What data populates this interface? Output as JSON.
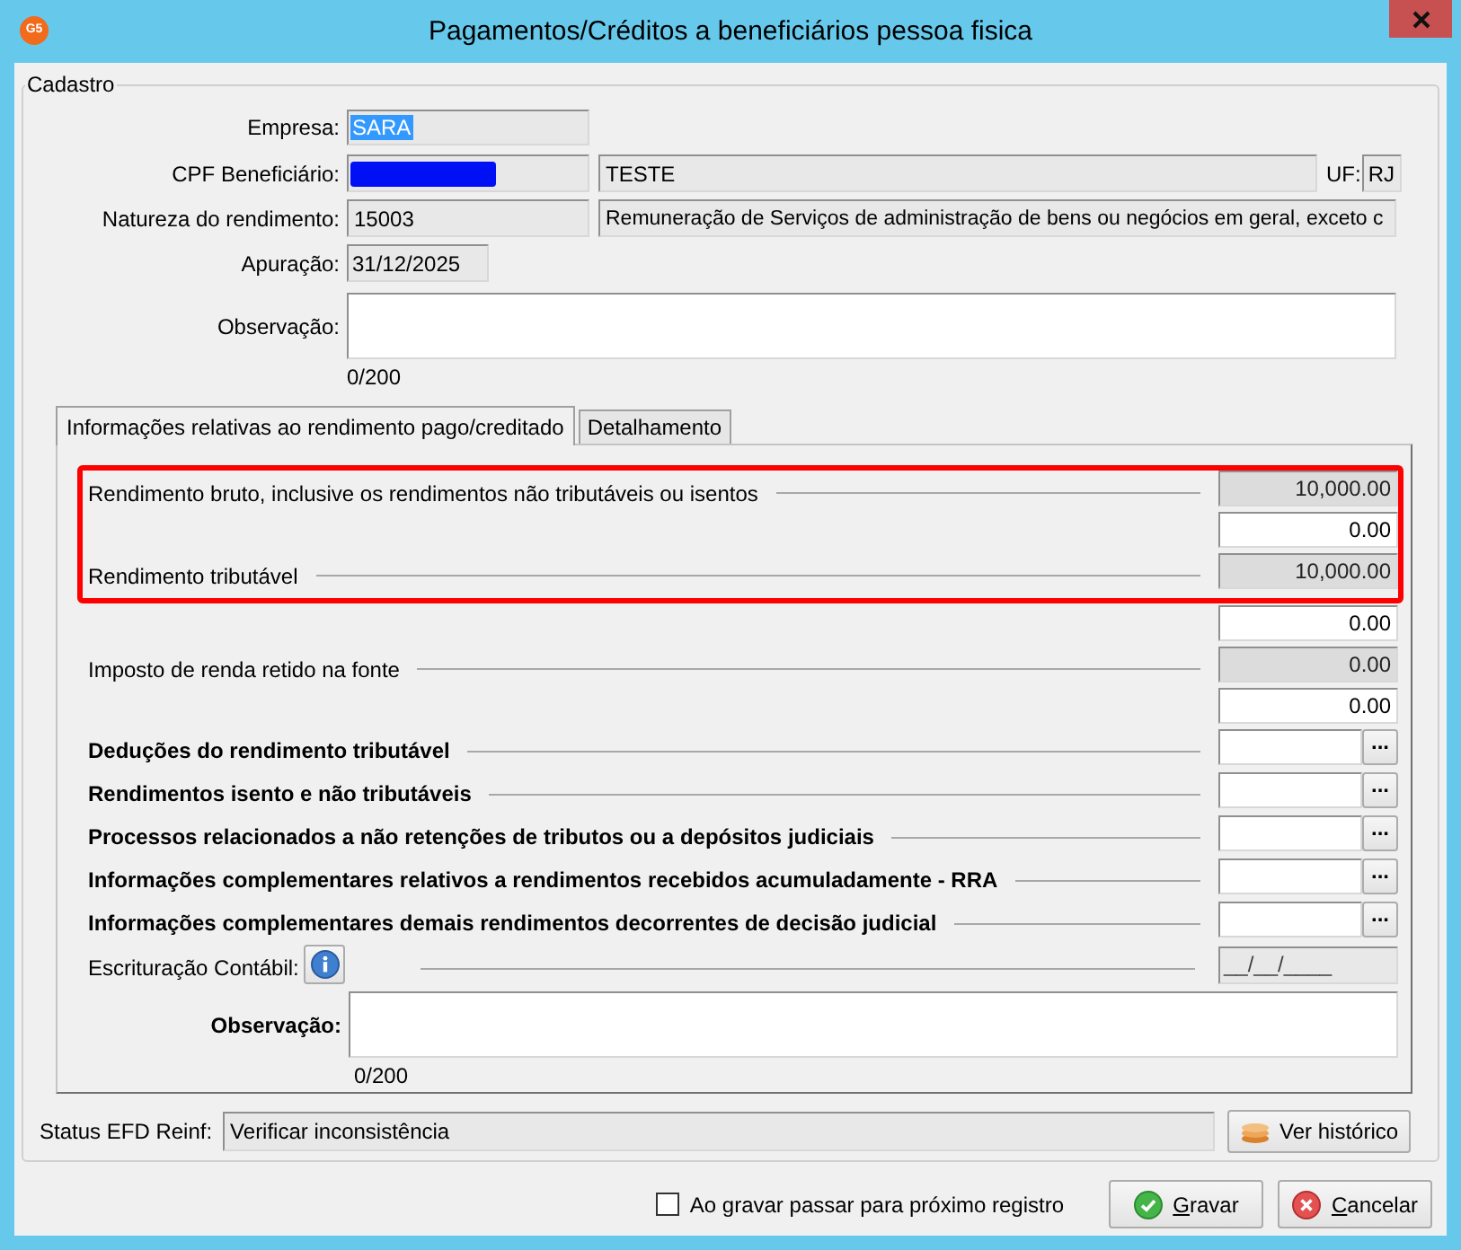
{
  "window": {
    "title": "Pagamentos/Créditos a beneficiários pessoa fisica",
    "logo": "G5"
  },
  "cadastro": {
    "title": "Cadastro",
    "empresa": {
      "label": "Empresa:",
      "value": "SARA",
      "text_selected": true
    },
    "cpf": {
      "label": "CPF Beneficiário:",
      "redacted": true,
      "name": "TESTE",
      "uf_label": "UF:",
      "uf": "RJ"
    },
    "natureza": {
      "label": "Natureza do rendimento:",
      "code": "15003",
      "description": "Remuneração de Serviços de administração de bens ou negócios em geral, exceto c"
    },
    "apuracao": {
      "label": "Apuração:",
      "value": "31/12/2025"
    },
    "observacao": {
      "label": "Observação:",
      "counter": "0/200"
    },
    "tabs": [
      {
        "label": "Informações relativas ao rendimento pago/creditado",
        "selected": true
      },
      {
        "label": "Detalhamento",
        "selected": false
      }
    ],
    "rendimento": {
      "amount_rows": [
        {
          "label": "Rendimento bruto, inclusive os rendimentos não tributáveis ou isentos",
          "value": "10,000.00",
          "readonly": true,
          "highlighted": true
        },
        {
          "value": "0.00",
          "readonly": false,
          "highlighted": true
        },
        {
          "label": "Rendimento tributável",
          "value": "10,000.00",
          "readonly": true,
          "highlighted": true
        },
        {
          "value": "0.00",
          "readonly": false,
          "highlighted": false
        },
        {
          "label": "Imposto de renda retido na fonte",
          "value": "0.00",
          "readonly": true,
          "highlighted": false
        },
        {
          "value": "0.00",
          "readonly": false,
          "highlighted": false
        }
      ],
      "lookup_rows": [
        {
          "label": "Deduções do rendimento tributável",
          "button": "..."
        },
        {
          "label": "Rendimentos isento e não tributáveis",
          "button": "..."
        },
        {
          "label": "Processos relacionados a não retenções de tributos ou a depósitos judiciais",
          "button": "..."
        },
        {
          "label": "Informações complementares relativos a rendimentos recebidos acumuladamente - RRA",
          "button": "..."
        },
        {
          "label": "Informações complementares demais rendimentos decorrentes de decisão judicial",
          "button": "..."
        }
      ],
      "escrituracao": {
        "label": "Escrituração Contábil:",
        "date": "__/__/____"
      },
      "observacao": {
        "label": "Observação:",
        "counter": "0/200"
      }
    },
    "status": {
      "label": "Status EFD Reinf:",
      "value": "Verificar inconsistência",
      "history_button": "Ver histórico"
    }
  },
  "footer": {
    "checkbox": {
      "label": "Ao gravar passar para próximo registro",
      "checked": false
    },
    "buttons": [
      {
        "kind": "save",
        "access_key": "G",
        "rest": "ravar"
      },
      {
        "kind": "cancel",
        "access_key": "C",
        "rest": "ancelar"
      }
    ]
  }
}
